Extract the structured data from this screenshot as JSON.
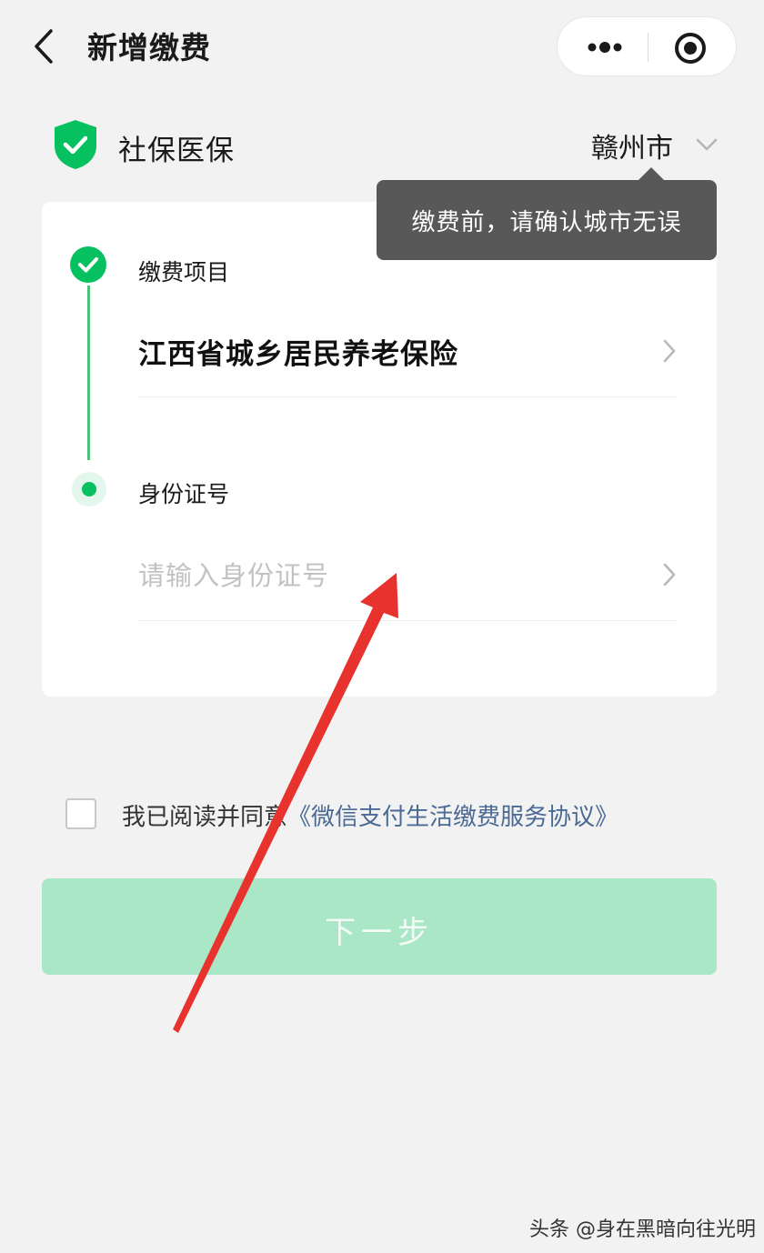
{
  "nav": {
    "title": "新增缴费",
    "back_icon": "back-arrow-icon",
    "more_icon": "more-dots-icon",
    "close_icon": "target-close-icon"
  },
  "service": {
    "name": "社保医保",
    "icon": "shield-check-icon",
    "city": "赣州市",
    "city_icon": "chevron-down-icon"
  },
  "tooltip": {
    "text": "缴费前，请确认城市无误"
  },
  "form": {
    "steps": [
      {
        "label": "缴费项目",
        "status": "done",
        "value": "江西省城乡居民养老保险"
      },
      {
        "label": "身份证号",
        "status": "current",
        "placeholder": "请输入身份证号",
        "value": ""
      }
    ]
  },
  "agreement": {
    "checked": false,
    "prefix": "我已阅读并同意",
    "link": "《微信支付生活缴费服务协议》"
  },
  "next_button": {
    "label": "下一步"
  },
  "watermark": "头条 @身在黑暗向往光明",
  "colors": {
    "accent": "#07c160",
    "step_line": "#4cc27a",
    "button_disabled": "#a9e7c6",
    "link": "#4a6a95",
    "tooltip_bg": "#585858",
    "annotation_arrow": "#e8322d"
  }
}
